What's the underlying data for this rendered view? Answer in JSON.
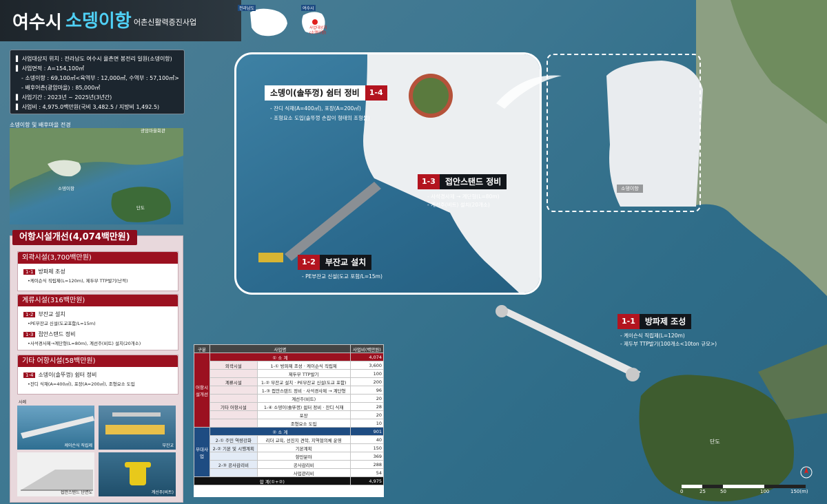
{
  "header": {
    "city": "여수시",
    "port": "소뎅이항",
    "subtitle": "어촌신활력증진사업"
  },
  "minimap": {
    "region1": "전라남도",
    "region2": "여수시",
    "target_label": "사업대상지 (소뎅이항)"
  },
  "info": {
    "lines": [
      "▌ 사업대상지 위치 : 전라남도 여수시 율촌면 봉전리 일원(소뎅이항)",
      "▌ 사업면적 : A=154,100㎡",
      "- 소뎅이항 : 69,100㎡<육역부 : 12,000㎡, 수역부 : 57,100㎡>",
      "- 배후어촌(광암마을) : 85,000㎡",
      "▌ 사업기간 : 2023년 ~ 2025년(3년간)",
      "▌ 사업비 : 4,975.0백만원(국비 3,482.5 / 지방비 1,492.5)"
    ]
  },
  "photo": {
    "caption": "소뎅이항 및 배후마을 전경",
    "labels": [
      "광암마을회관",
      "소뎅이항",
      "단도"
    ]
  },
  "panel": {
    "title": "어항시설개선(4,074백만원)",
    "sections": [
      {
        "head": "외곽시설(3,700백만원)",
        "items": [
          {
            "tag": "1-1",
            "title": "방파제 조성",
            "desc": "•케이슨식 직립제(L=120m), 제두부 TTP발기(난적)"
          }
        ]
      },
      {
        "head": "계류시설(316백만원)",
        "items": [
          {
            "tag": "1-2",
            "title": "부잔교 설치",
            "desc": "•PE부잔교 신설(도교포함/L=15m)"
          },
          {
            "tag": "1-3",
            "title": "접안스탠드 정비",
            "desc": "•사석경사제→계단형(L=80m), 계선주(비트) 설치(20개소)"
          }
        ]
      },
      {
        "head": "기타 어항시설(58백만원)",
        "items": [
          {
            "tag": "1-4",
            "title": "소뎅이(솔뚜껑) 쉼터 정비",
            "desc": "•잔디 식재(A=400㎡), 포장(A=200㎡), 조형요소 도입"
          }
        ]
      }
    ],
    "photos_label": "사례",
    "thumbs": [
      "케이슨식 직립제",
      "부잔교",
      "접안스탠드 단면도",
      "계선주(비트)"
    ]
  },
  "map": {
    "callouts": [
      {
        "num": "1-4",
        "text": "소뎅이(솔뚜껑) 쉼터 정비"
      },
      {
        "num": "1-3",
        "text": "접안스탠드 정비"
      },
      {
        "num": "1-2",
        "text": "부잔교 설치"
      },
      {
        "num": "1-1",
        "text": "방파제 조성"
      }
    ],
    "notes": {
      "n14a": "- 잔디 식재(A=400㎡), 포장(A=200㎡)",
      "n14b": "- 조형요소 도입(솔뚜껑 손잡이 형태의 조형물)",
      "n13a": "- 사석경사제 → 계단형(L=80m)",
      "n13b": "- 계선주(비트) 설치(20개소)",
      "n12": "- PE부잔교 신설(도교 포함/L=15m)",
      "n11a": "- 케이슨식 직립제(L=120m)",
      "n11b": "- 제두부 TTP발기(100개소<10ton 규모>)"
    },
    "place_port": "소뎅이항",
    "place_island": "단도"
  },
  "table": {
    "headers": [
      "구분",
      "사업명",
      "사업비(백만원)"
    ],
    "sub1": {
      "label": "① 소 계",
      "value": "4,074"
    },
    "cat1": "어항시설개선",
    "rows1": [
      {
        "g": "외곽시설",
        "n": "1-① 방파제 조성",
        "d": "케이슨식 직립제",
        "v": "3,600"
      },
      {
        "g": "",
        "n": "",
        "d": "제두부 TTP발기",
        "v": "100"
      },
      {
        "g": "계류시설",
        "n": "1-② 부잔교 설치",
        "d": "PE부잔교 신설(도교 포함)",
        "v": "200"
      },
      {
        "g": "",
        "n": "1-③ 접안스탠드 정비",
        "d": "사석경사제 → 계단형",
        "v": "96"
      },
      {
        "g": "",
        "n": "",
        "d": "계선주(비트)",
        "v": "20"
      },
      {
        "g": "기타 어항시설",
        "n": "1-④ 소뎅이(솔뚜껑) 쉼터 정비",
        "d": "잔디 식재",
        "v": "28"
      },
      {
        "g": "",
        "n": "",
        "d": "포장",
        "v": "20"
      },
      {
        "g": "",
        "n": "",
        "d": "조형요소 도입",
        "v": "10"
      }
    ],
    "sub2": {
      "label": "② 소 계",
      "value": "901"
    },
    "cat2": "부대사업",
    "rows2": [
      {
        "n": "2-① 주민 역량강화",
        "d": "리더 교육, 선진지 견학, 지역협의체 운영",
        "v": "40"
      },
      {
        "n": "2-② 기본 및 시행계획",
        "d": "기본계획",
        "v": "150"
      },
      {
        "n": "",
        "d": "항만분야",
        "v": "369"
      },
      {
        "n": "2-③ 공사감리비",
        "d": "공사감리비",
        "v": "288"
      },
      {
        "n": "",
        "d": "사업관리비",
        "v": "54"
      }
    ],
    "total": {
      "label": "합 계(①+②)",
      "value": "4,975"
    }
  },
  "scale": {
    "ticks": [
      "0",
      "25",
      "50",
      "100",
      "150(m)"
    ]
  }
}
